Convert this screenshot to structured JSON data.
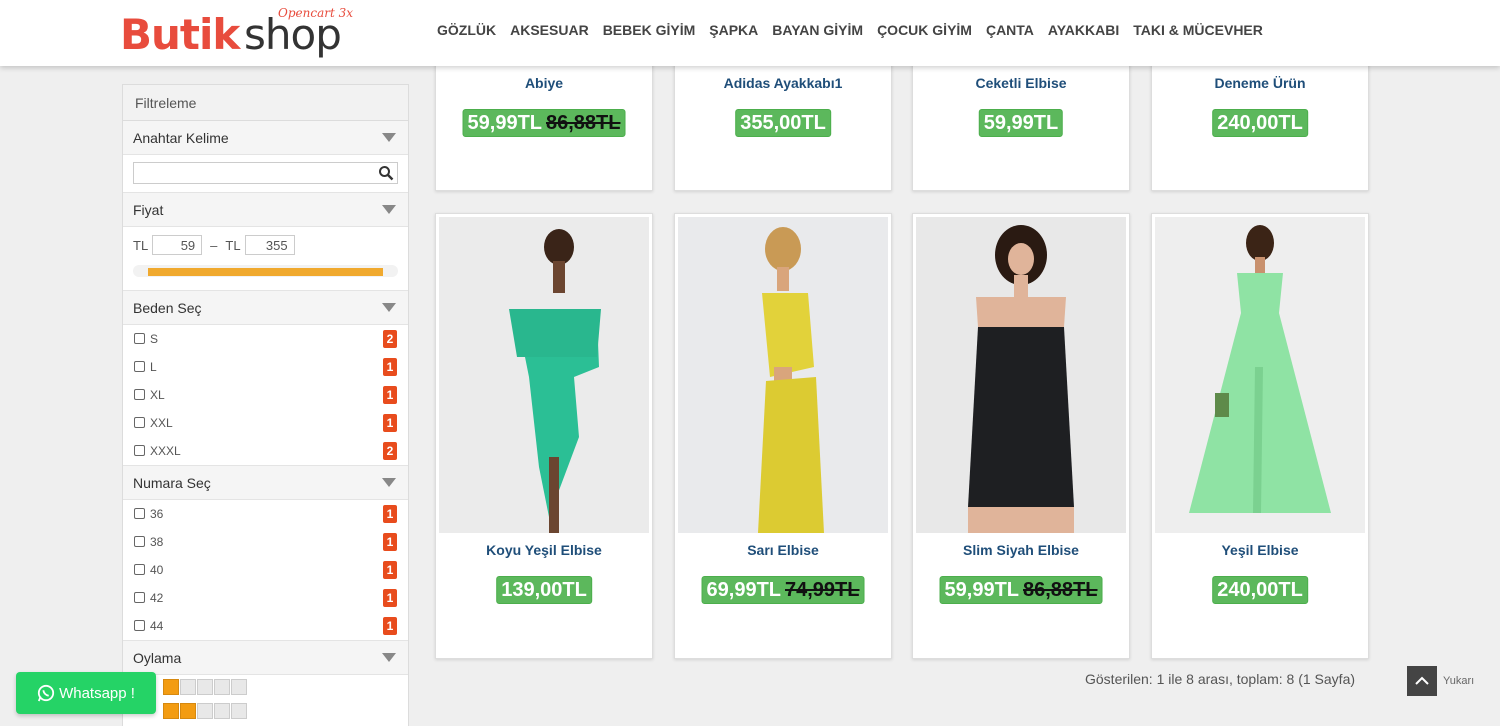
{
  "logo": {
    "main": "Butik",
    "accent": "shop",
    "sub": "Opencart 3x"
  },
  "nav": [
    "GÖZLÜK",
    "AKSESUAR",
    "BEBEK GİYİM",
    "ŞAPKA",
    "BAYAN GİYİM",
    "ÇOCUK GİYİM",
    "ÇANTA",
    "AYAKKABI",
    "TAKI & MÜCEVHER"
  ],
  "sidebar": {
    "title": "Filtreleme",
    "keyword": {
      "label": "Anahtar Kelime",
      "value": ""
    },
    "price": {
      "label": "Fiyat",
      "currency": "TL",
      "min": "59",
      "max": "355",
      "sep": "–"
    },
    "size": {
      "label": "Beden Seç",
      "options": [
        {
          "label": "S",
          "count": "2"
        },
        {
          "label": "L",
          "count": "1"
        },
        {
          "label": "XL",
          "count": "1"
        },
        {
          "label": "XXL",
          "count": "1"
        },
        {
          "label": "XXXL",
          "count": "2"
        }
      ]
    },
    "number": {
      "label": "Numara Seç",
      "options": [
        {
          "label": "36",
          "count": "1"
        },
        {
          "label": "38",
          "count": "1"
        },
        {
          "label": "40",
          "count": "1"
        },
        {
          "label": "42",
          "count": "1"
        },
        {
          "label": "44",
          "count": "1"
        }
      ]
    },
    "rating": {
      "label": "Oylama",
      "rows": [
        1,
        2
      ]
    }
  },
  "products_top": [
    {
      "name": "Abiye",
      "price": "59,99TL",
      "old": "86,88TL"
    },
    {
      "name": "Adidas Ayakkabı1",
      "price": "355,00TL",
      "old": ""
    },
    {
      "name": "Ceketli Elbise",
      "price": "59,99TL",
      "old": ""
    },
    {
      "name": "Deneme Ürün",
      "price": "240,00TL",
      "old": ""
    }
  ],
  "products_bottom": [
    {
      "name": "Koyu Yeşil Elbise",
      "price": "139,00TL",
      "old": "",
      "color": "#2bbf95"
    },
    {
      "name": "Sarı Elbise",
      "price": "69,99TL",
      "old": "74,99TL",
      "color": "#e2d23a"
    },
    {
      "name": "Slim Siyah Elbise",
      "price": "59,99TL",
      "old": "86,88TL",
      "color": "#1e1f22"
    },
    {
      "name": "Yeşil Elbise",
      "price": "240,00TL",
      "old": "",
      "color": "#8fe3a4"
    }
  ],
  "results": "Gösterilen: 1 ile 8 arası, toplam: 8 (1 Sayfa)",
  "back_to_top": "Yukarı",
  "whatsapp": "Whatsapp !",
  "colors": {
    "brand": "#e84c3d",
    "price": "#5cb85c",
    "badge": "#e84c1d",
    "slider": "#f0a92e",
    "whatsapp": "#25d366"
  }
}
